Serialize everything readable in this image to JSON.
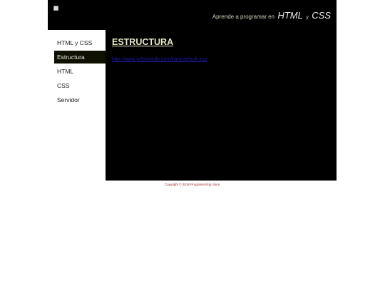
{
  "header": {
    "tagline_prefix": "Aprende a programar en",
    "tagline_html": "HTML",
    "tagline_and": "y",
    "tagline_css": "CSS"
  },
  "sidebar": {
    "items": [
      {
        "label": "HTML y CSS",
        "active": false
      },
      {
        "label": "Estructura",
        "active": true
      },
      {
        "label": "HTML",
        "active": false
      },
      {
        "label": "CSS",
        "active": false
      },
      {
        "label": "Servidor",
        "active": false
      }
    ]
  },
  "main": {
    "title": "ESTRUCTURA",
    "link_text": "http://www.w3schools.com/html/default.asp"
  },
  "footer": {
    "text": "Copyright © 2016 Programa Ergo Sum"
  },
  "colors": {
    "header_bg": "#000000",
    "content_bg": "#000000",
    "active_nav_bg": "#101000",
    "footer_text": "#8b1a1a"
  }
}
